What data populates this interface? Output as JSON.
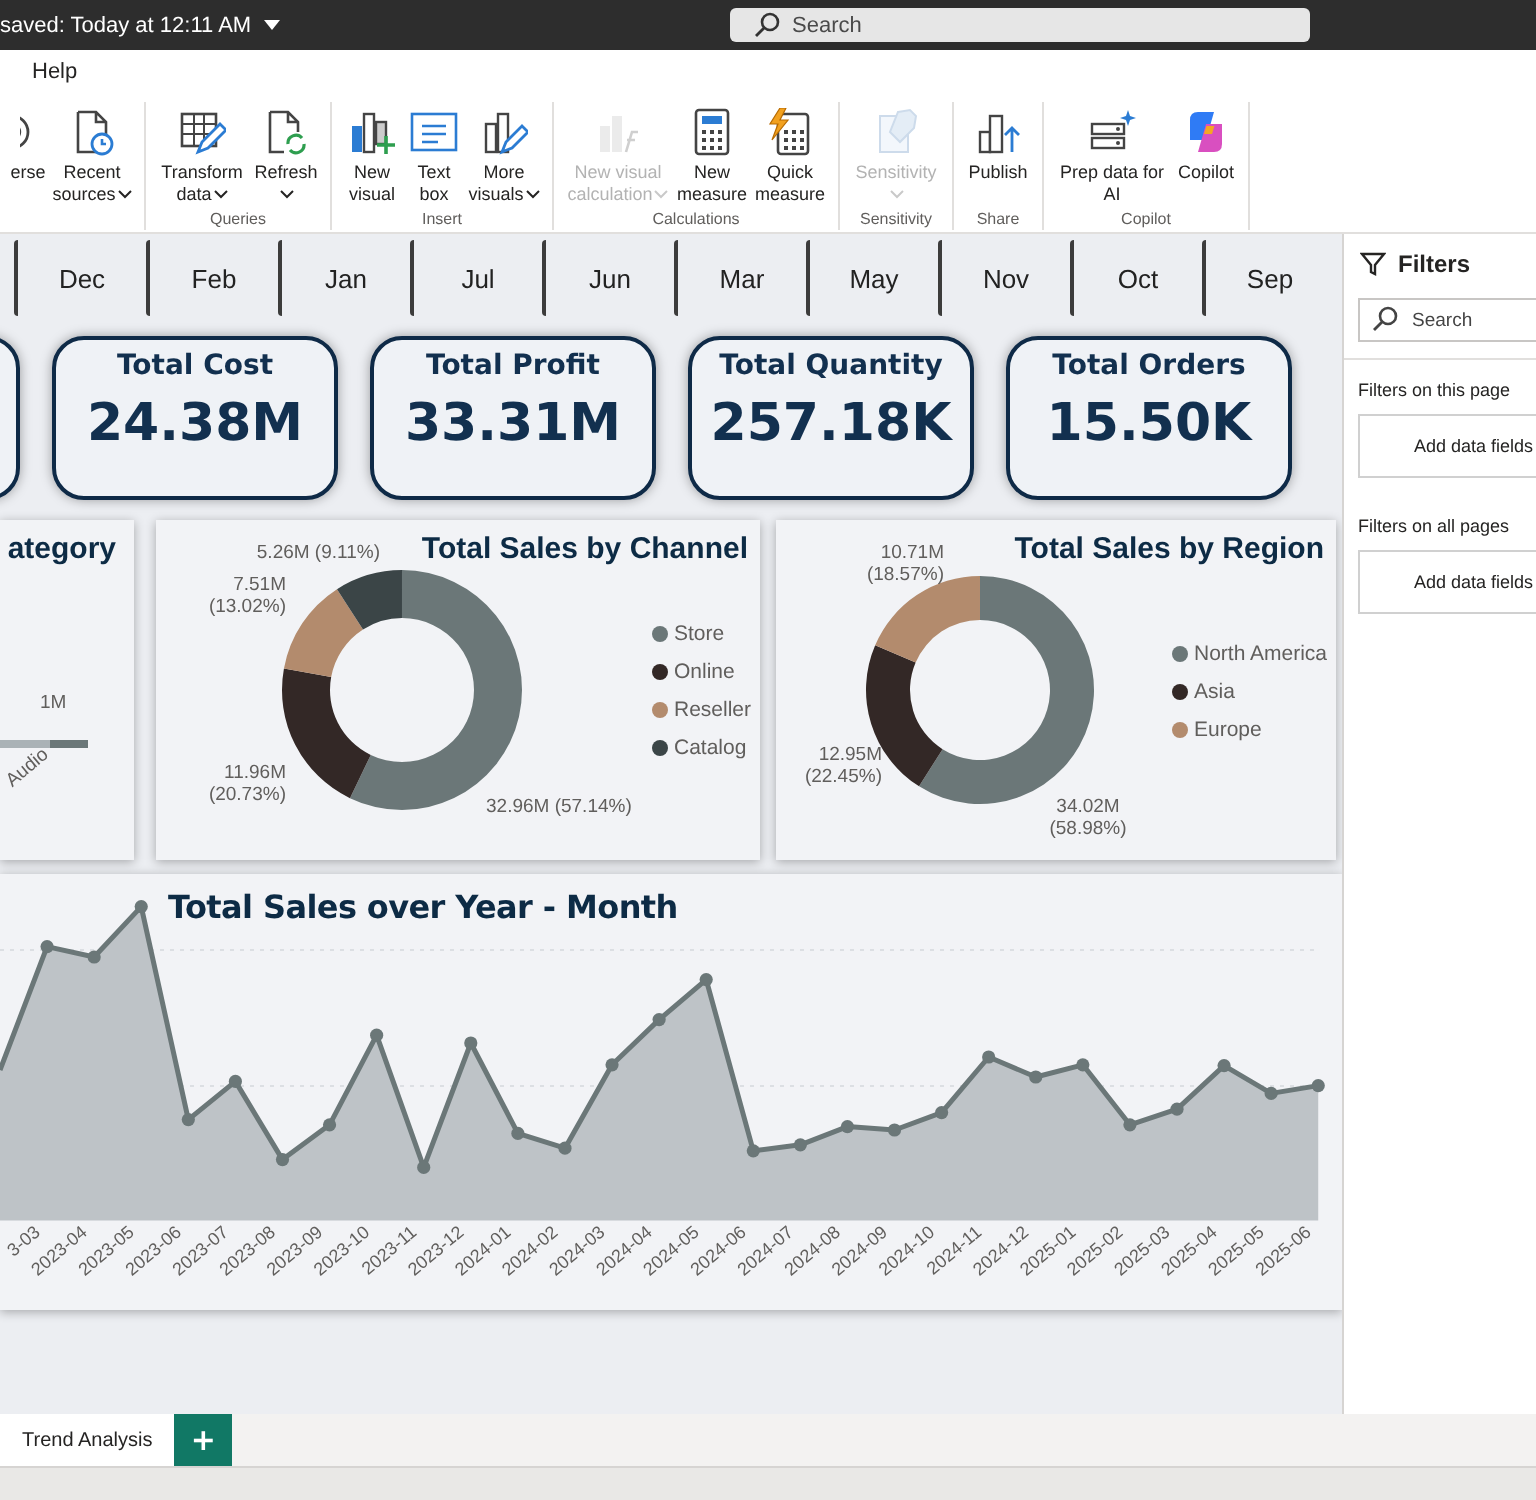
{
  "title_bar": {
    "save_status": "saved: Today at 12:11 AM",
    "search": {
      "placeholder": "Search"
    }
  },
  "menu": [
    {
      "label": "Help",
      "selected": false
    }
  ],
  "ribbon": {
    "groups": [
      {
        "buttons": [
          {
            "label": "erse",
            "dropdown": false,
            "disabled": false
          },
          {
            "label": "Recent sources",
            "dropdown": true,
            "disabled": false
          }
        ]
      },
      {
        "label": "Queries",
        "buttons": [
          {
            "label": "Transform data",
            "dropdown": true,
            "disabled": false
          },
          {
            "label": "Refresh",
            "dropdown": true,
            "disabled": false
          }
        ]
      },
      {
        "label": "Insert",
        "buttons": [
          {
            "label": "New visual",
            "dropdown": false,
            "disabled": false
          },
          {
            "label": "Text box",
            "dropdown": false,
            "disabled": false
          },
          {
            "label": "More visuals",
            "dropdown": true,
            "disabled": false
          }
        ]
      },
      {
        "label": "Calculations",
        "buttons": [
          {
            "label": "New visual calculation",
            "dropdown": true,
            "disabled": true
          },
          {
            "label": "New measure",
            "dropdown": false,
            "disabled": false
          },
          {
            "label": "Quick measure",
            "dropdown": false,
            "disabled": false
          }
        ]
      },
      {
        "label": "Sensitivity",
        "buttons": [
          {
            "label": "Sensitivity",
            "dropdown": true,
            "disabled": true
          }
        ]
      },
      {
        "label": "Share",
        "buttons": [
          {
            "label": "Publish",
            "dropdown": false,
            "disabled": false
          }
        ]
      },
      {
        "label": "Copilot",
        "buttons": [
          {
            "label": "Prep data for AI",
            "dropdown": false,
            "disabled": false
          },
          {
            "label": "Copilot",
            "dropdown": false,
            "disabled": false
          }
        ]
      }
    ]
  },
  "month_slicer": [
    {
      "label": "Dec",
      "selected": false
    },
    {
      "label": "Feb",
      "selected": false
    },
    {
      "label": "Jan",
      "selected": false
    },
    {
      "label": "Jul",
      "selected": false
    },
    {
      "label": "Jun",
      "selected": false
    },
    {
      "label": "Mar",
      "selected": false
    },
    {
      "label": "May",
      "selected": false
    },
    {
      "label": "Nov",
      "selected": false
    },
    {
      "label": "Oct",
      "selected": false
    },
    {
      "label": "Sep",
      "selected": false
    }
  ],
  "kpi_cards": [
    {
      "title": "Total Cost",
      "value": "24.38M"
    },
    {
      "title": "Total Profit",
      "value": "33.31M"
    },
    {
      "title": "Total Quantity",
      "value": "257.18K"
    },
    {
      "title": "Total Orders",
      "value": "15.50K"
    }
  ],
  "category_chart": {
    "title": "ategory",
    "value_label": "1M",
    "category_label": "Audio"
  },
  "donut_charts": [
    {
      "title": "Total Sales by Channel",
      "legend": [
        {
          "color": "#6b7778"
        },
        {
          "color": "#332826"
        },
        {
          "color": "#b38b6d"
        },
        {
          "color": "#3b4547"
        }
      ],
      "chart_data": {
        "type": "donut",
        "categories": [
          "Store",
          "Online",
          "Reseller",
          "Catalog"
        ],
        "values": [
          57.14,
          20.73,
          13.02,
          9.11
        ],
        "value_labels": [
          "32.96M (57.14%)",
          "11.96M (20.73%)",
          "7.51M (13.02%)",
          "5.26M (9.11%)"
        ]
      }
    },
    {
      "title": "Total Sales by Region",
      "legend": [
        {
          "color": "#6b7778"
        },
        {
          "color": "#332826"
        },
        {
          "color": "#b38b6d"
        }
      ],
      "chart_data": {
        "type": "donut",
        "categories": [
          "North America",
          "Asia",
          "Europe"
        ],
        "values": [
          58.98,
          22.45,
          18.57
        ],
        "value_labels": [
          "34.02M (58.98%)",
          "12.95M (22.45%)",
          "10.71M (18.57%)"
        ]
      }
    }
  ],
  "line_chart": {
    "title": "Total Sales over Year - Month",
    "x_labels": [
      "3-03",
      "2023-04",
      "2023-05",
      "2023-06",
      "2023-07",
      "2023-08",
      "2023-09",
      "2023-10",
      "2023-11",
      "2023-12",
      "2024-01",
      "2024-02",
      "2024-03",
      "2024-04",
      "2024-05",
      "2024-06",
      "2024-07",
      "2024-08",
      "2024-09",
      "2024-10",
      "2024-11",
      "2024-12",
      "2025-01",
      "2025-02",
      "2025-03",
      "2025-04",
      "2025-05",
      "2025-06"
    ]
  },
  "filters": {
    "title": "Filters",
    "search": {
      "placeholder": "Search"
    },
    "sections": [
      {
        "heading": "Filters on this page",
        "drop_hint": "Add data fields"
      },
      {
        "heading": "Filters on all pages",
        "drop_hint": "Add data fields"
      }
    ]
  },
  "page_tabs": [
    {
      "label": "Trend Analysis",
      "selected": true
    }
  ],
  "new_page_button": "+"
}
